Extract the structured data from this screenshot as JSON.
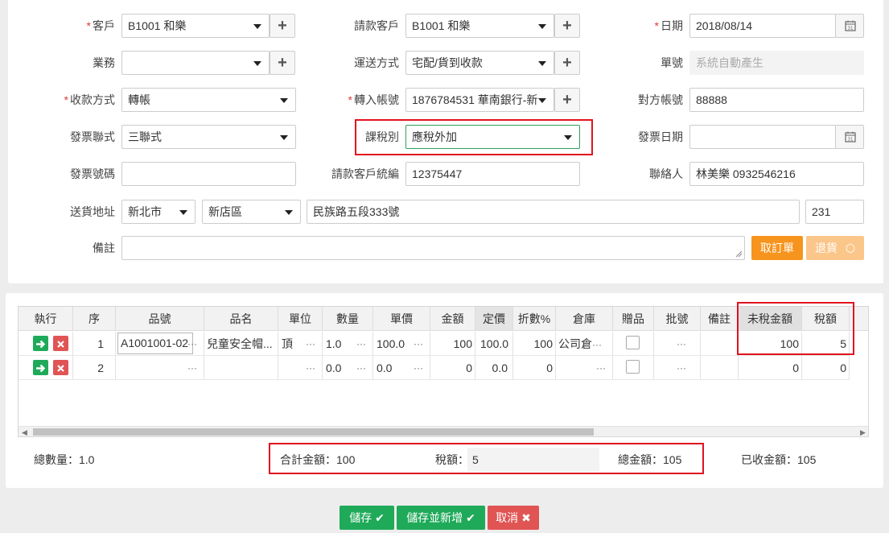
{
  "form": {
    "customer_label": "客戶",
    "customer_value": "B1001 和樂",
    "bill_customer_label": "請款客戶",
    "bill_customer_value": "B1001 和樂",
    "date_label": "日期",
    "date_value": "2018/08/14",
    "business_label": "業務",
    "business_value": "",
    "delivery_label": "運送方式",
    "delivery_value": "宅配/貨到收款",
    "order_no_label": "單號",
    "order_no_placeholder": "系統自動產生",
    "payment_label": "收款方式",
    "payment_value": "轉帳",
    "transfer_label": "轉入帳號",
    "transfer_value": "1876784531 華南銀行-新",
    "other_account_label": "對方帳號",
    "other_account_value": "88888",
    "invoice_type_label": "發票聯式",
    "invoice_type_value": "三聯式",
    "tax_type_label": "課稅別",
    "tax_type_value": "應稅外加",
    "invoice_date_label": "發票日期",
    "invoice_date_value": "",
    "invoice_no_label": "發票號碼",
    "invoice_no_value": "",
    "bill_customer_id_label": "請款客戶統編",
    "bill_customer_id_value": "12375447",
    "contact_label": "聯絡人",
    "contact_value": "林美樂 0932546216",
    "address_label": "送貨地址",
    "city_value": "新北市",
    "district_value": "新店區",
    "street_value": "民族路五段333號",
    "zip_value": "231",
    "note_label": "備註",
    "note_value": "",
    "cancel_order_label": "取訂單",
    "return_label": "退貨"
  },
  "grid": {
    "headers": [
      "執行",
      "序",
      "品號",
      "品名",
      "單位",
      "數量",
      "單價",
      "金額",
      "定價",
      "折數%",
      "倉庫",
      "贈品",
      "批號",
      "備註",
      "未稅金額",
      "稅額"
    ],
    "rows": [
      {
        "seq": "1",
        "item_no": "A1001001-02",
        "item_name": "兒童安全帽...",
        "unit": "頂",
        "qty": "1.0",
        "price": "100.0",
        "amount": "100",
        "list_price": "100.0",
        "discount": "100",
        "warehouse": "公司倉",
        "pretax": "100",
        "tax": "5"
      },
      {
        "seq": "2",
        "item_no": "",
        "item_name": "",
        "unit": "",
        "qty": "0.0",
        "price": "0.0",
        "amount": "0",
        "list_price": "0.0",
        "discount": "0",
        "warehouse": "",
        "pretax": "0",
        "tax": "0"
      }
    ]
  },
  "summary": {
    "total_qty": "總數量：1.0",
    "subtotal": "合計金額：100",
    "tax_label": "稅額：",
    "tax_value": "5",
    "grand_total": "總金額：105",
    "received": "已收金額：105"
  },
  "footer": {
    "save_label": "儲存",
    "save_new_label": "儲存並新增",
    "cancel_label": "取消"
  },
  "colors": {
    "green": "#1faa59",
    "red": "#e05454",
    "orange": "#f7941d",
    "orange_light": "#fbc689",
    "highlight": "#e0131f"
  }
}
